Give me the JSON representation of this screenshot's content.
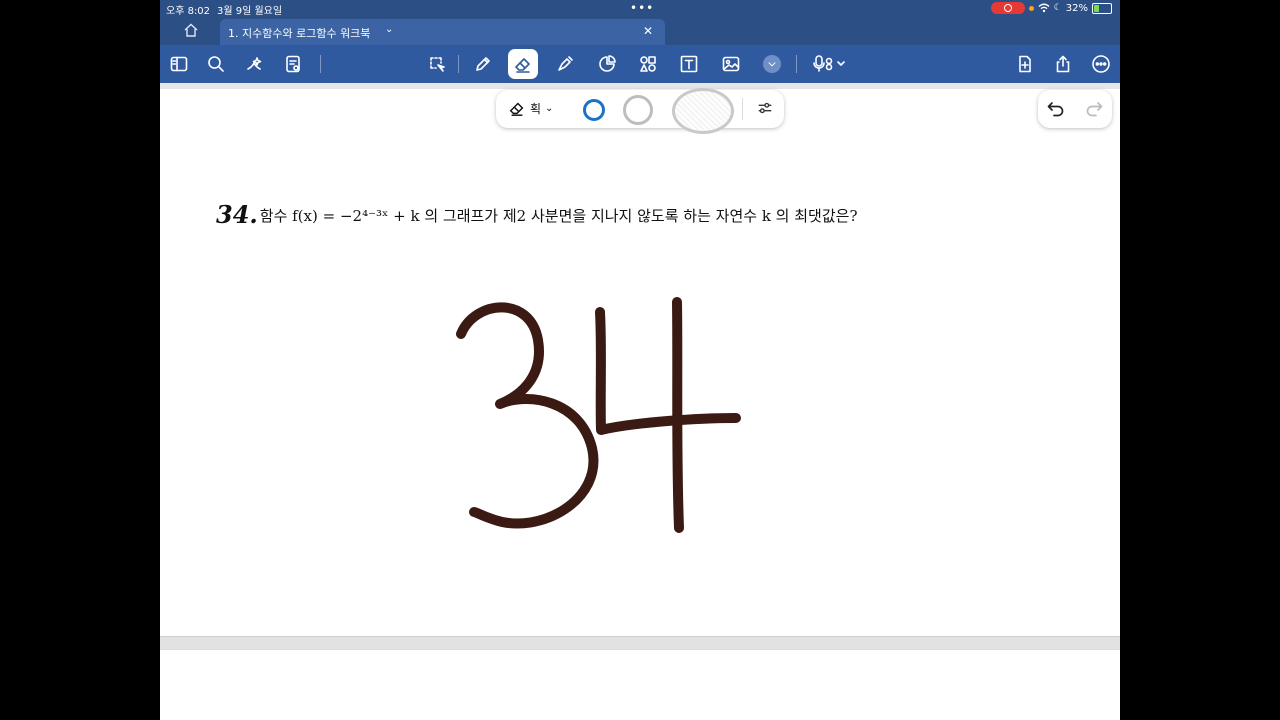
{
  "status_bar": {
    "time": "오후 8:02",
    "date": "3월 9일 월요일",
    "battery": "32%",
    "battery_level": 0.32
  },
  "tab": {
    "title": "1. 지수함수와 로그함수 워크북"
  },
  "pen_panel": {
    "eraser_mode": "획"
  },
  "problem": {
    "number": "34.",
    "text": "함수  f(x) = −2⁴⁻³ˣ + k 의  그래프가  제2 사분면을  지나지  않도록  하는  자연수  k 의  최댓값은?"
  },
  "handwriting": {
    "answer": "34",
    "ink_color": "#3a1a12"
  },
  "colors": {
    "toolbar": "#2f5aa0",
    "status_bar": "#2c4f86",
    "accent": "#1a73c9",
    "record": "#e53935"
  },
  "icons": {
    "toolbar": [
      "sidebar-icon",
      "search-icon",
      "sparkle-icon",
      "notes-icon",
      "lasso-icon",
      "pen-icon",
      "eraser-icon",
      "highlighter-icon",
      "shapes-icon",
      "elements-icon",
      "text-icon",
      "image-icon",
      "chevron-down-icon",
      "microphone-icon",
      "add-page-icon",
      "share-icon",
      "more-icon"
    ]
  }
}
